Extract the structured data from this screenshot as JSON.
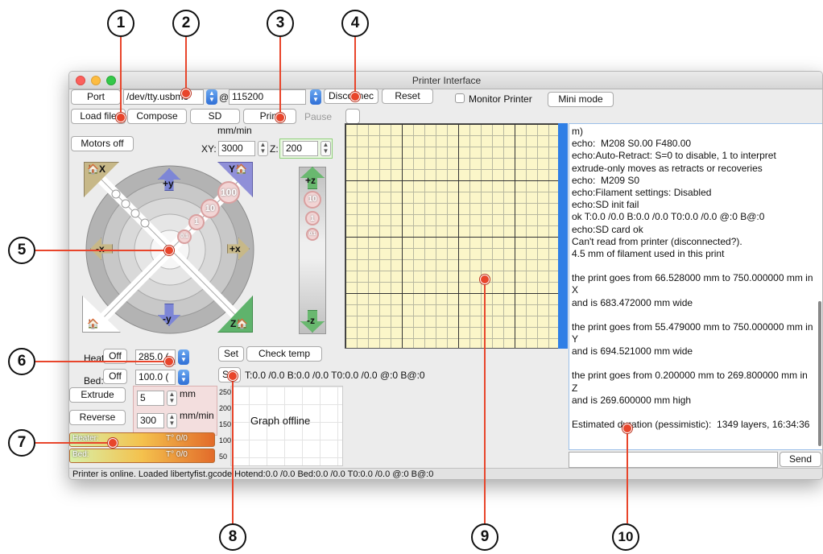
{
  "window": {
    "title": "Printer Interface"
  },
  "toolbar": {
    "port_label": "Port",
    "port_value": "/dev/tty.usbmo",
    "at_symbol": "@",
    "baud_value": "115200",
    "disconnect_label": "Disconnec",
    "reset_label": "Reset",
    "monitor_label": "Monitor Printer",
    "mini_mode_label": "Mini mode"
  },
  "toolbar2": {
    "load_label": "Load file",
    "compose_label": "Compose",
    "sd_label": "SD",
    "print_label": "Print",
    "pause_label": "Pause"
  },
  "controls": {
    "motors_off_label": "Motors off",
    "feed_label": "mm/min",
    "xy_label": "XY:",
    "xy_value": "3000",
    "z_label": "Z:",
    "z_value": "200",
    "jog": {
      "home_x": "X",
      "home_y": "Y",
      "home_z": "Z",
      "plus_y": "+y",
      "minus_y": "-y",
      "plus_x": "+x",
      "minus_x": "-x",
      "plus_z": "+z",
      "minus_z": "-z",
      "steps": [
        "100",
        "10",
        "1",
        "0.1"
      ],
      "z_steps": [
        "10",
        "1",
        "0.1"
      ]
    }
  },
  "temps": {
    "heater_label": "Heater:",
    "heater_off": "Off",
    "heater_value": "285.0 (",
    "bed_label": "Bed:",
    "bed_off": "Off",
    "bed_value": "100.0 (",
    "set_label": "Set",
    "check_temp_label": "Check temp",
    "set2_label": "Set",
    "temp_readout": "T:0.0 /0.0 B:0.0 /0.0 T0:0.0 /0.0 @:0 B@:0"
  },
  "extrude": {
    "extrude_label": "Extrude",
    "extrude_value": "5",
    "extrude_unit": "mm",
    "reverse_label": "Reverse",
    "reverse_value": "300",
    "reverse_unit": "mm/min"
  },
  "gauges": {
    "heater_label": "Heater:",
    "heater_value": "T° 0/0",
    "bed_label": "Bed:",
    "bed_value": "T° 0/0"
  },
  "graph": {
    "offline_text": "Graph offline",
    "yticks": [
      "250",
      "200",
      "150",
      "100",
      "50"
    ]
  },
  "console": {
    "lines": [
      "m)",
      "echo:  M208 S0.00 F480.00",
      "echo:Auto-Retract: S=0 to disable, 1 to interpret extrude-only moves as retracts or recoveries",
      "echo:  M209 S0",
      "echo:Filament settings: Disabled",
      "echo:SD init fail",
      "ok T:0.0 /0.0 B:0.0 /0.0 T0:0.0 /0.0 @:0 B@:0",
      "echo:SD card ok",
      "Can't read from printer (disconnected?).",
      "4.5 mm of filament used in this print",
      "",
      "the print goes from 66.528000 mm to 750.000000 mm in X",
      "and is 683.472000 mm wide",
      "",
      "the print goes from 55.479000 mm to 750.000000 mm in Y",
      "and is 694.521000 mm wide",
      "",
      "the print goes from 0.200000 mm to 269.800000 mm in Z",
      "and is 269.600000 mm high",
      "",
      "Estimated duration (pessimistic):  1349 layers, 16:34:36"
    ],
    "send_label": "Send"
  },
  "status": {
    "text": "Printer is online. Loaded libertyfist.gcode  Hotend:0.0 /0.0 Bed:0.0 /0.0 T0:0.0 /0.0 @:0 B@:0"
  },
  "callouts": [
    "1",
    "2",
    "3",
    "4",
    "5",
    "6",
    "7",
    "8",
    "9",
    "10"
  ],
  "colors": {
    "accent_blue": "#2f7fe6",
    "callout_red": "#e8452b",
    "grid_bg": "#fbf6c9"
  }
}
